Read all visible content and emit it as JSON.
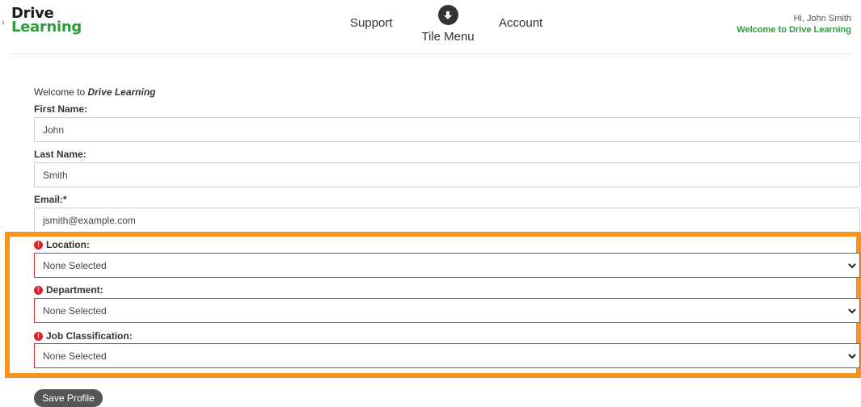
{
  "header": {
    "logo_mark": "›",
    "logo_line1": "Drive",
    "logo_line2": "Learning",
    "nav": {
      "support": "Support",
      "tile_menu": "Tile Menu",
      "account": "Account"
    },
    "greeting": "Hi, John Smith",
    "welcome": "Welcome to Drive Learning"
  },
  "form": {
    "welcome_prefix": "Welcome to ",
    "welcome_brand": "Drive Learning",
    "first_name": {
      "label": "First Name:",
      "value": "John"
    },
    "last_name": {
      "label": "Last Name:",
      "value": "Smith"
    },
    "email": {
      "label": "Email:*",
      "value": "jsmith@example.com"
    },
    "location": {
      "label": "Location:",
      "value": "None Selected"
    },
    "department": {
      "label": "Department:",
      "value": "None Selected"
    },
    "job_classification": {
      "label": "Job Classification:",
      "value": "None Selected"
    },
    "error_icon": "!",
    "save_label": "Save Profile"
  },
  "colors": {
    "brand_green": "#2e9b3e",
    "error_red": "#e0303a",
    "highlight_orange": "#f7941d"
  }
}
